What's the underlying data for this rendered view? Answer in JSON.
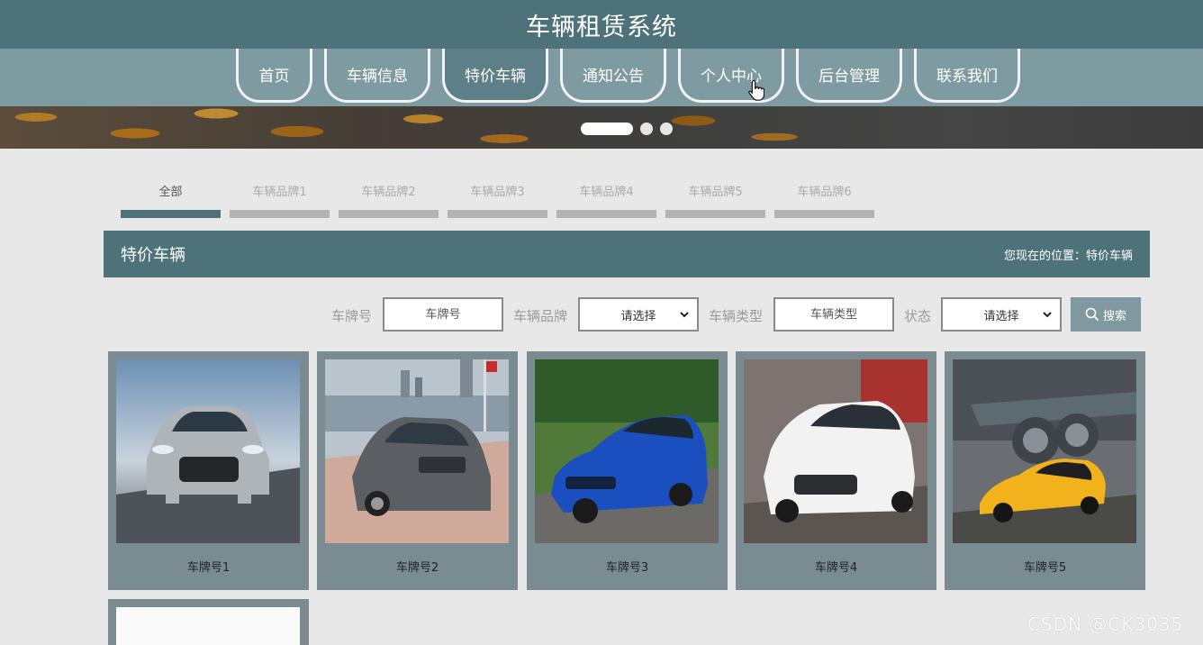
{
  "header": {
    "title": "车辆租赁系统"
  },
  "nav": {
    "items": [
      {
        "label": "首页"
      },
      {
        "label": "车辆信息"
      },
      {
        "label": "特价车辆"
      },
      {
        "label": "通知公告"
      },
      {
        "label": "个人中心"
      },
      {
        "label": "后台管理"
      },
      {
        "label": "联系我们"
      }
    ],
    "active_index": 2
  },
  "banner": {
    "slides_count": 3,
    "active_slide": 1
  },
  "brand_tabs": [
    {
      "label": "全部"
    },
    {
      "label": "车辆品牌1"
    },
    {
      "label": "车辆品牌2"
    },
    {
      "label": "车辆品牌3"
    },
    {
      "label": "车辆品牌4"
    },
    {
      "label": "车辆品牌5"
    },
    {
      "label": "车辆品牌6"
    }
  ],
  "section": {
    "title": "特价车辆",
    "breadcrumb_prefix": "您现在的位置：",
    "breadcrumb_current": "特价车辆"
  },
  "search": {
    "plate_label": "车牌号",
    "plate_placeholder": "车牌号",
    "brand_label": "车辆品牌",
    "brand_selected": "请选择",
    "type_label": "车辆类型",
    "type_placeholder": "车辆类型",
    "status_label": "状态",
    "status_selected": "请选择",
    "button_label": "搜索"
  },
  "cars": [
    {
      "name": "车牌号1",
      "color": "silver"
    },
    {
      "name": "车牌号2",
      "color": "gray"
    },
    {
      "name": "车牌号3",
      "color": "blue"
    },
    {
      "name": "车牌号4",
      "color": "white"
    },
    {
      "name": "车牌号5",
      "color": "yellow"
    }
  ],
  "colors": {
    "primary": "#4d727a",
    "nav_bg": "#7f9ba2",
    "card_bg": "#7a8c92",
    "search_button": "#8099a0",
    "page_bg": "#e9e8e8"
  },
  "watermark": "CSDN @CK3035"
}
